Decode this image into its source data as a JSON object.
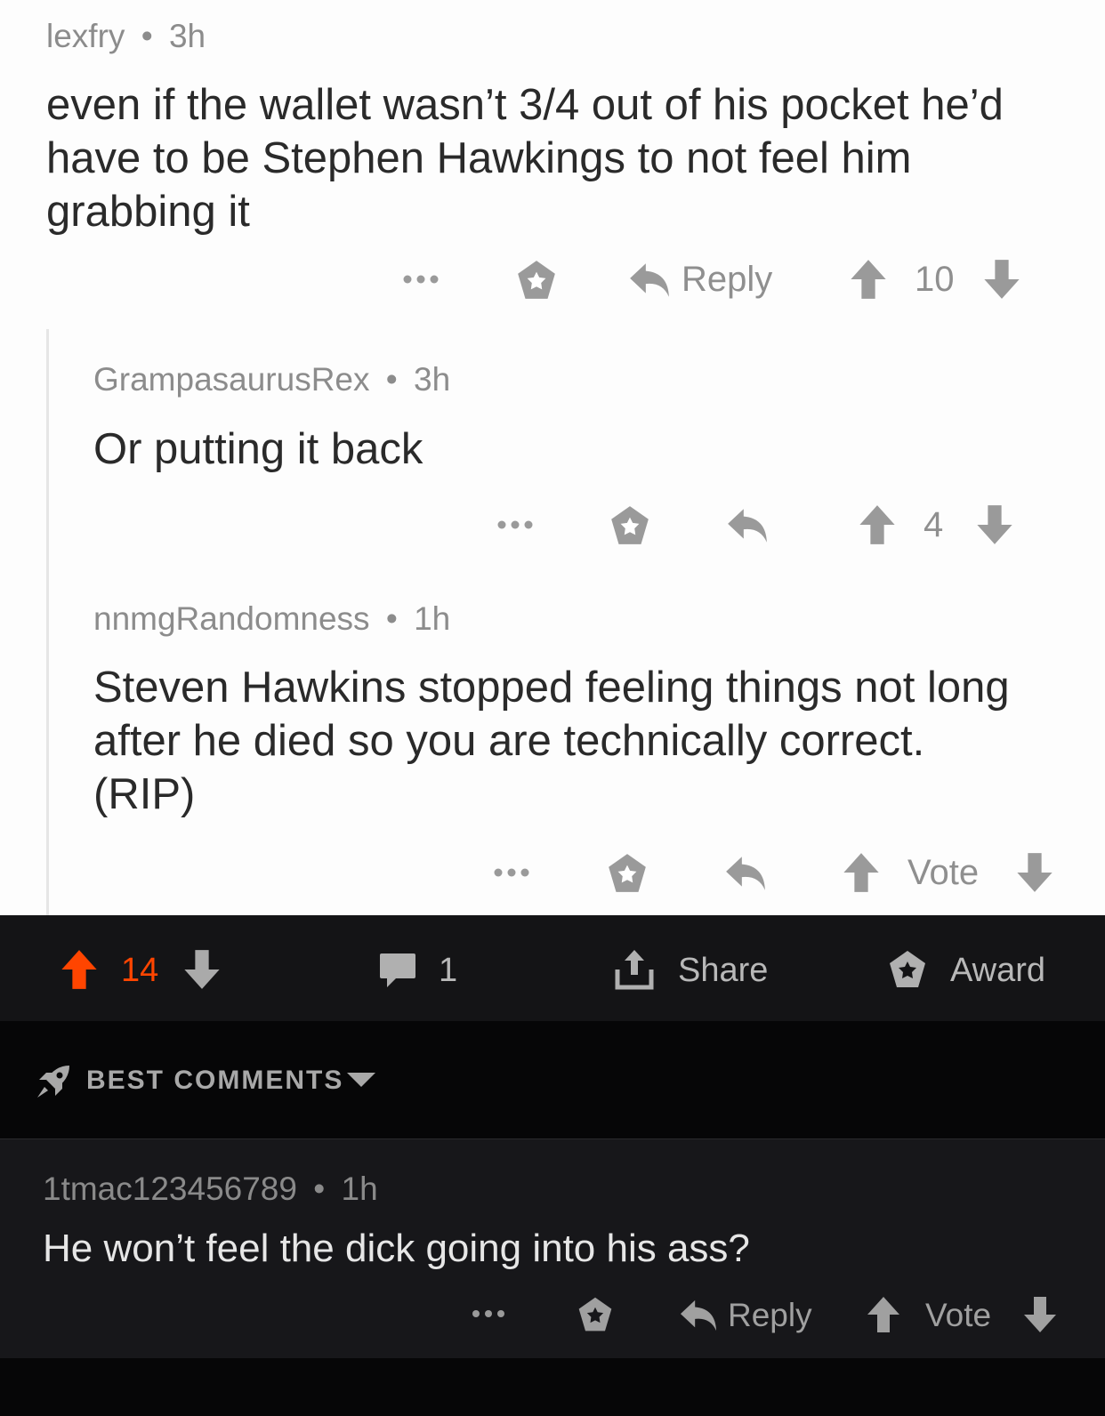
{
  "thread": {
    "comments": [
      {
        "author": "lexfry",
        "time": "3h",
        "line1": "even if the wallet wasn’t 3/4 out of his pocket he’d",
        "line2": "have to be Stephen Hawkings to not feel him",
        "line3": "grabbing it",
        "reply_label": "Reply",
        "score": "10"
      },
      {
        "author": "GrampasaurusRex",
        "time": "3h",
        "line1": "Or putting it back",
        "score": "4"
      },
      {
        "author": "nnmgRandomness",
        "time": "1h",
        "line1": "Steven Hawkins stopped feeling things not long",
        "line2": "after he died so you are technically correct.",
        "line3": "(RIP)",
        "score": "Vote"
      }
    ]
  },
  "post_bar": {
    "upvotes": "14",
    "comments_count": "1",
    "share_label": "Share",
    "award_label": "Award"
  },
  "sort": {
    "label": "BEST COMMENTS"
  },
  "bottom_comment": {
    "author": "1tmac123456789",
    "time": "1h",
    "text": "He won’t feel the dick going into his ass?",
    "reply_label": "Reply",
    "vote_label": "Vote"
  },
  "colors": {
    "upvote_active": "#ff4500",
    "dark_background": "#141416",
    "light_background": "#fdfdfd"
  },
  "separator": "•"
}
